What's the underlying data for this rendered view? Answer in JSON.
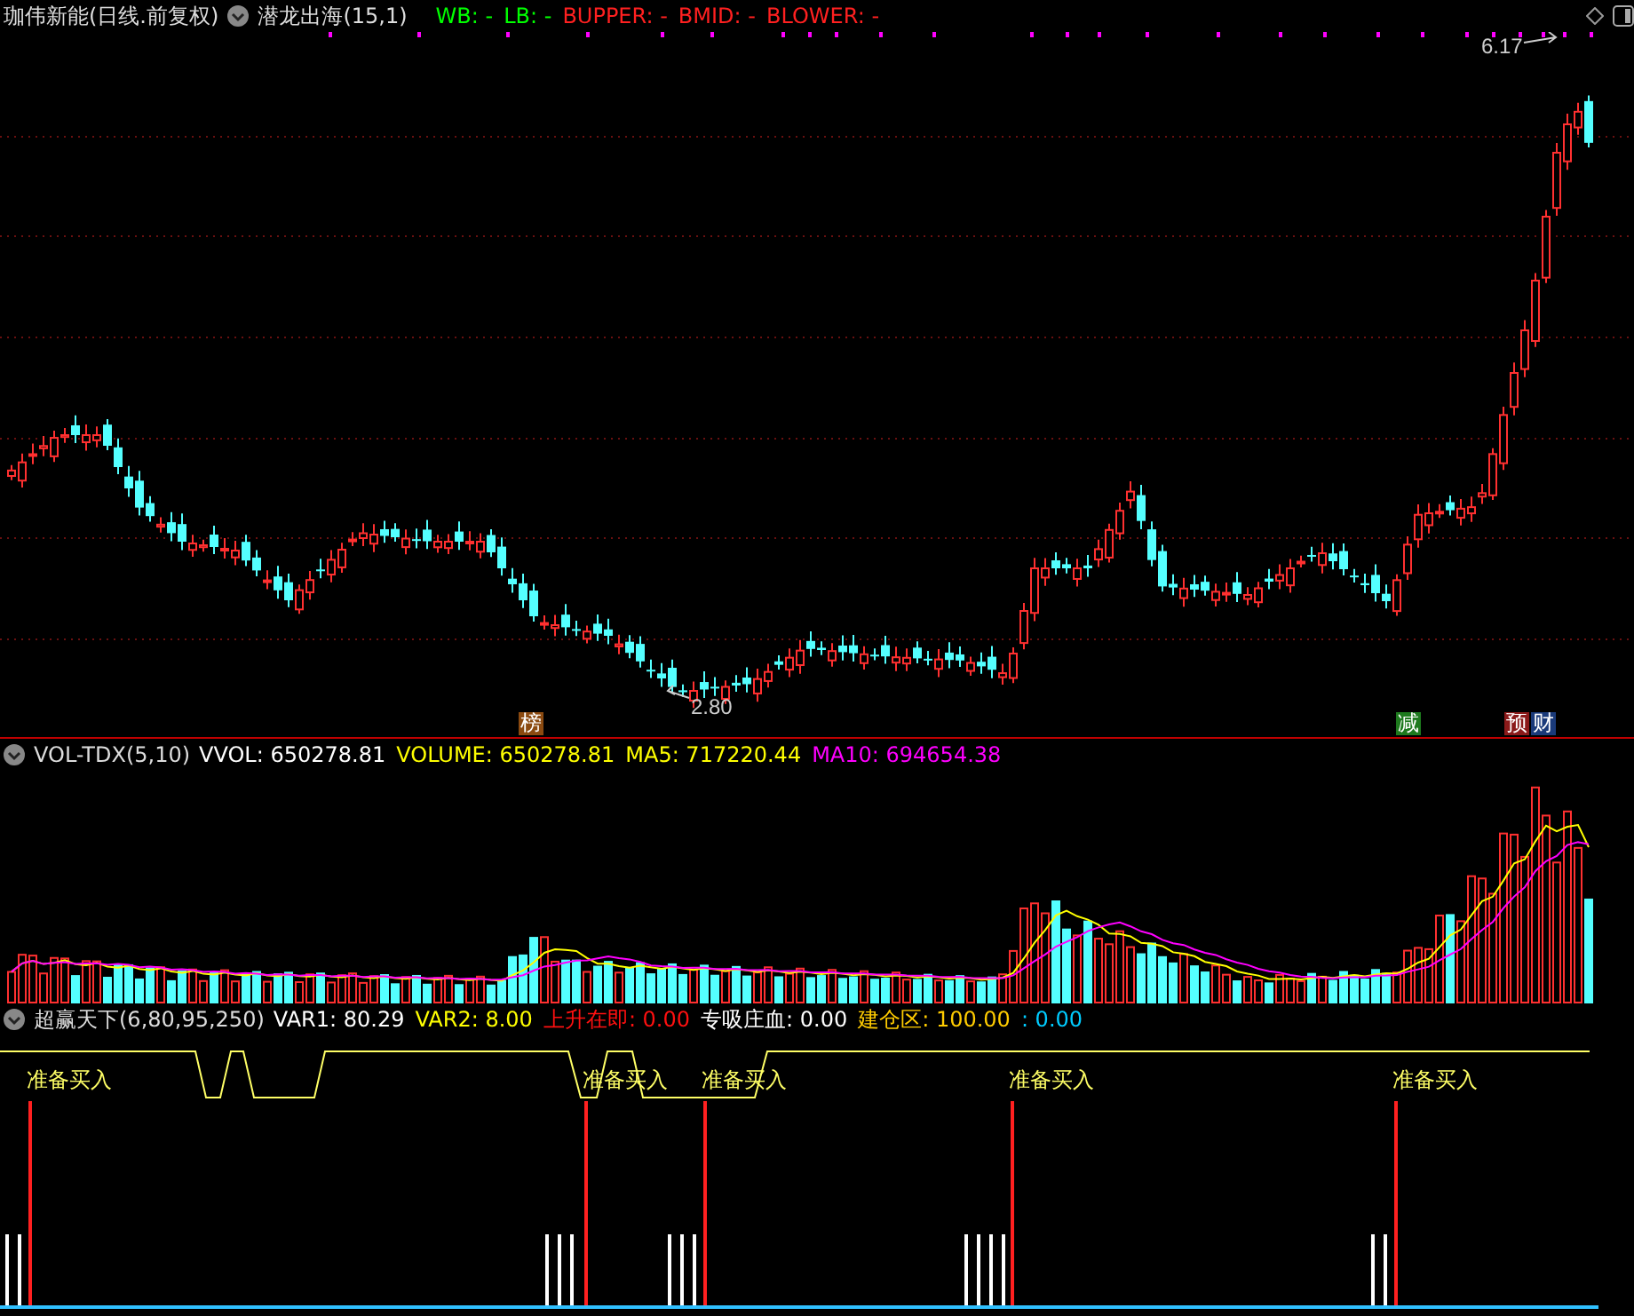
{
  "header": {
    "title": "珈伟新能(日线.前复权)",
    "indicator": "潜龙出海(15,1)",
    "legend": [
      {
        "text": "WB: -",
        "color": "#00ff00"
      },
      {
        "text": "LB: -",
        "color": "#00ff00"
      },
      {
        "text": "BUPPER: -",
        "color": "#ff2020"
      },
      {
        "text": "BMID: -",
        "color": "#ff2020"
      },
      {
        "text": "BLOWER: -",
        "color": "#ff2020"
      }
    ]
  },
  "main_chart": {
    "high_label": "6.17",
    "low_label": "2.80",
    "badges": [
      {
        "text": "榜",
        "color": "#8b4a10"
      },
      {
        "text": "减",
        "color": "#1e7a1e"
      },
      {
        "text": "预",
        "color": "#8b1a1a"
      },
      {
        "text": "财",
        "color": "#1a3a7a"
      }
    ]
  },
  "volume_panel": {
    "indicator": "VOL-TDX(5,10)",
    "legend": [
      {
        "text": "VVOL: 650278.81",
        "color": "#ffffff"
      },
      {
        "text": "VOLUME: 650278.81",
        "color": "#ffff00"
      },
      {
        "text": "MA5: 717220.44",
        "color": "#ffff00"
      },
      {
        "text": "MA10: 694654.38",
        "color": "#ff00ff"
      }
    ]
  },
  "signal_panel": {
    "indicator": "超赢天下(6,80,95,250)",
    "legend": [
      {
        "text": "VAR1: 80.29",
        "color": "#ffffff"
      },
      {
        "text": "VAR2: 8.00",
        "color": "#ffff00"
      },
      {
        "text": "上升在即: 0.00",
        "color": "#ff1010"
      },
      {
        "text": "专吸庄血: 0.00",
        "color": "#ffffff"
      },
      {
        "text": "建仓区: 100.00",
        "color": "#ffcc00"
      },
      {
        "text": ": 0.00",
        "color": "#00ccff"
      }
    ],
    "signals": [
      "准备买入",
      "准备买入",
      "准备买入",
      "准备买入",
      "准备买入"
    ]
  }
}
